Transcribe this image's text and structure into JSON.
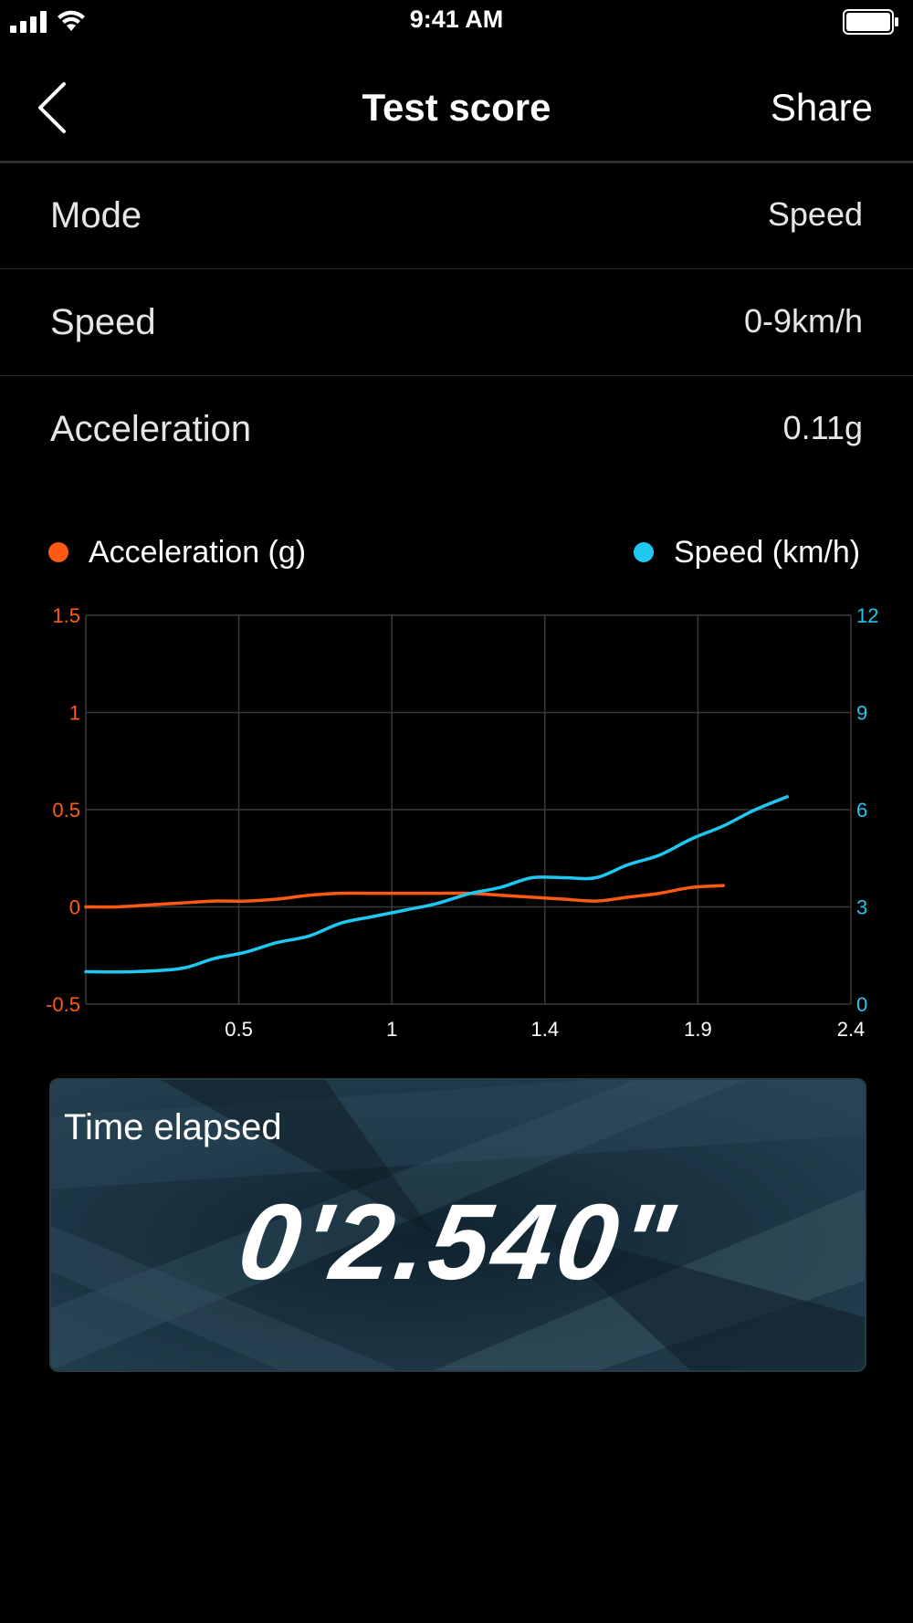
{
  "status_bar": {
    "time": "9:41 AM",
    "icons": [
      "signal-icon",
      "wifi-icon",
      "battery-icon"
    ]
  },
  "nav": {
    "back_icon": "chevron-left-icon",
    "title": "Test score",
    "share_label": "Share"
  },
  "info_rows": [
    {
      "label": "Mode",
      "value": "Speed"
    },
    {
      "label": "Speed",
      "value": "0-9km/h"
    },
    {
      "label": "Acceleration",
      "value": "0.11g"
    }
  ],
  "legend": {
    "acceleration_label": "Acceleration (g)",
    "speed_label": "Speed (km/h)"
  },
  "colors": {
    "acceleration": "#ff5a14",
    "speed": "#1ec8f0",
    "grid": "#3a3a3a"
  },
  "chart_data": {
    "type": "line",
    "xlim": [
      0,
      2.4
    ],
    "x_ticks": [
      "0.5",
      "1",
      "1.4",
      "1.9",
      "2.4"
    ],
    "y_left_ticks": [
      "1.5",
      "1",
      "0.5",
      "0",
      "-0.5"
    ],
    "y_right_ticks": [
      "12",
      "9",
      "6",
      "3",
      "0"
    ],
    "y_left_range": [
      -0.5,
      1.5
    ],
    "y_right_range": [
      0,
      12
    ],
    "grid": true,
    "series": [
      {
        "name": "Acceleration (g)",
        "axis": "left",
        "x": [
          0,
          0.1,
          0.2,
          0.3,
          0.4,
          0.5,
          0.6,
          0.7,
          0.8,
          0.9,
          1.0,
          1.1,
          1.2,
          1.3,
          1.4,
          1.5,
          1.6,
          1.7,
          1.8,
          1.9,
          2.0
        ],
        "y": [
          0.0,
          0.0,
          0.01,
          0.02,
          0.03,
          0.03,
          0.04,
          0.06,
          0.07,
          0.07,
          0.07,
          0.07,
          0.07,
          0.06,
          0.05,
          0.04,
          0.03,
          0.05,
          0.07,
          0.1,
          0.11
        ]
      },
      {
        "name": "Speed (km/h)",
        "axis": "right",
        "x": [
          0,
          0.15,
          0.3,
          0.4,
          0.5,
          0.6,
          0.7,
          0.8,
          0.9,
          1.0,
          1.1,
          1.2,
          1.3,
          1.4,
          1.5,
          1.6,
          1.7,
          1.8,
          1.9,
          2.0,
          2.1,
          2.2
        ],
        "y": [
          1.0,
          1.0,
          1.1,
          1.4,
          1.6,
          1.9,
          2.1,
          2.5,
          2.7,
          2.9,
          3.1,
          3.4,
          3.6,
          3.9,
          3.9,
          3.9,
          4.3,
          4.6,
          5.1,
          5.5,
          6.0,
          6.4
        ]
      }
    ]
  },
  "time_card": {
    "label": "Time elapsed",
    "value": "0'2.540\""
  }
}
